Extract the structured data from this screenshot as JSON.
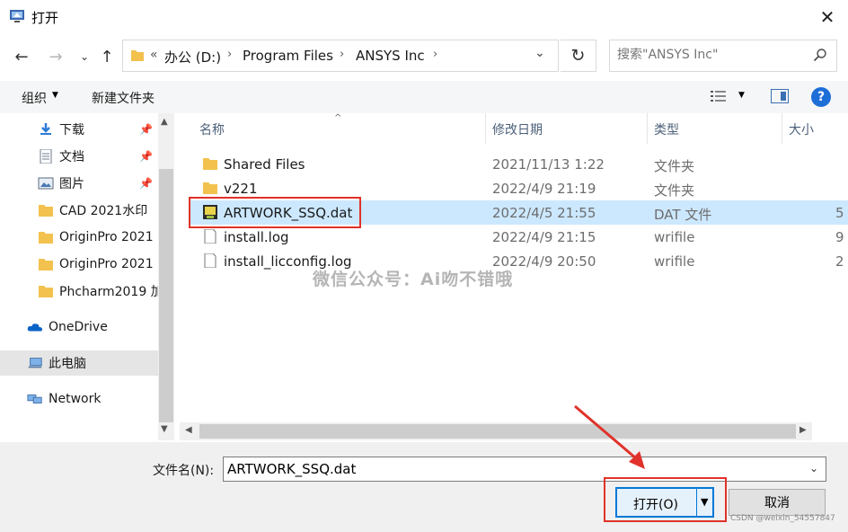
{
  "window": {
    "title": "打开",
    "close_glyph": "✕"
  },
  "address": {
    "chevron": "«",
    "crumbs": [
      "办公 (D:)",
      "Program Files",
      "ANSYS Inc"
    ],
    "separator": "›",
    "dropdown_glyph": "⌄",
    "refresh_glyph": "↻"
  },
  "nav_buttons": {
    "back": "←",
    "forward": "→",
    "history": "⌄",
    "up": "↑"
  },
  "search": {
    "placeholder": "搜索\"ANSYS Inc\"",
    "icon": "search-icon"
  },
  "toolbar": {
    "organize_label": "组织",
    "organize_caret": "▼",
    "new_folder_label": "新建文件夹",
    "view_caret": "▼",
    "help_label": "?"
  },
  "nav": {
    "items": [
      {
        "label": "下载",
        "icon": "download-icon",
        "pinned": true
      },
      {
        "label": "文档",
        "icon": "document-icon",
        "pinned": true
      },
      {
        "label": "图片",
        "icon": "picture-icon",
        "pinned": true
      },
      {
        "label": "CAD 2021水印",
        "icon": "folder-icon",
        "pinned": false
      },
      {
        "label": "OriginPro 2021",
        "icon": "folder-icon",
        "pinned": false
      },
      {
        "label": "OriginPro 2021",
        "icon": "folder-icon",
        "pinned": false
      },
      {
        "label": "Phcharm2019 加",
        "icon": "folder-icon",
        "pinned": false
      },
      {
        "label": "OneDrive",
        "icon": "onedrive-icon",
        "pinned": false
      },
      {
        "label": "此电脑",
        "icon": "this-pc-icon",
        "pinned": false
      },
      {
        "label": "Network",
        "icon": "network-icon",
        "pinned": false
      }
    ],
    "pin_glyph": "📌",
    "scroll_up": "▲",
    "scroll_down": "▼"
  },
  "columns": {
    "name": "名称",
    "date": "修改日期",
    "type": "类型",
    "size": "大小",
    "sort_glyph": "^"
  },
  "files": [
    {
      "name": "Shared Files",
      "date": "2021/11/13 1:22",
      "type": "文件夹",
      "size": "",
      "icon": "folder-icon"
    },
    {
      "name": "v221",
      "date": "2022/4/9 21:19",
      "type": "文件夹",
      "size": "",
      "icon": "folder-icon"
    },
    {
      "name": "ARTWORK_SSQ.dat",
      "date": "2022/4/5 21:55",
      "type": "DAT 文件",
      "size": "5",
      "icon": "dat-file-icon",
      "selected": true
    },
    {
      "name": "install.log",
      "date": "2022/4/9 21:15",
      "type": "wrifile",
      "size": "9",
      "icon": "text-file-icon"
    },
    {
      "name": "install_licconfig.log",
      "date": "2022/4/9 20:50",
      "type": "wrifile",
      "size": "2",
      "icon": "text-file-icon"
    }
  ],
  "watermark": "微信公众号：Ai吻不错哦",
  "hscroll": {
    "left": "◀",
    "right": "▶"
  },
  "bottom": {
    "filename_label": "文件名(N):",
    "filename_value": "ARTWORK_SSQ.dat",
    "filename_dd": "⌄",
    "open_label": "打开(O)",
    "open_caret": "▼",
    "cancel_label": "取消",
    "csdn": "CSDN @weixin_54557847"
  },
  "colors": {
    "selection": "#cce8ff",
    "annotation_red": "#e0322a",
    "accent_blue": "#0078d7"
  }
}
